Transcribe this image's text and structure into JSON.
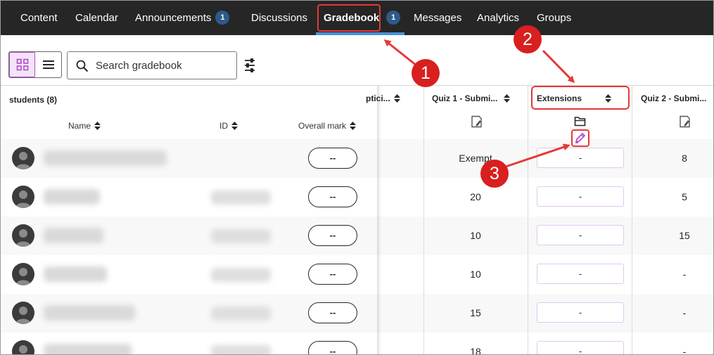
{
  "nav": {
    "items": [
      {
        "label": "Content"
      },
      {
        "label": "Calendar"
      },
      {
        "label": "Announcements",
        "badge": "1"
      },
      {
        "label": "Discussions"
      },
      {
        "label": "Gradebook",
        "badge": "1"
      },
      {
        "label": "Messages"
      },
      {
        "label": "Analytics"
      },
      {
        "label": "Groups"
      }
    ],
    "active": "Gradebook"
  },
  "toolbar": {
    "search_placeholder": "Search gradebook",
    "icons": [
      "grid-view-icon",
      "list-view-icon",
      "search-icon",
      "filter-settings-icon"
    ]
  },
  "grid": {
    "students_title": "students (8)",
    "columns": {
      "name": "Name",
      "id": "ID",
      "overall": "Overall mark"
    },
    "grade_columns": [
      {
        "label": "ptici..."
      },
      {
        "label": "Quiz 1 - Submi...",
        "icon": "assignment-icon"
      },
      {
        "label": "Extensions",
        "icon": "folder-icon"
      },
      {
        "label": "Quiz 2 - Submi...",
        "icon": "assignment-icon"
      }
    ],
    "rows": [
      {
        "overall": "--",
        "quiz1": "Exempt",
        "extension": "-",
        "quiz2": "8"
      },
      {
        "overall": "--",
        "quiz1": "20",
        "extension": "-",
        "quiz2": "5"
      },
      {
        "overall": "--",
        "quiz1": "10",
        "extension": "-",
        "quiz2": "15"
      },
      {
        "overall": "--",
        "quiz1": "10",
        "extension": "-",
        "quiz2": "-"
      },
      {
        "overall": "--",
        "quiz1": "15",
        "extension": "-",
        "quiz2": "-"
      },
      {
        "overall": "--",
        "quiz1": "18",
        "extension": "-",
        "quiz2": "-"
      }
    ]
  },
  "annotations": {
    "callouts": [
      "1",
      "2",
      "3"
    ],
    "color": "#d91f1f"
  },
  "colors": {
    "nav_bg": "#262626",
    "badge": "#2d5a8b",
    "accent_purple": "#b04cc9",
    "active_underline": "#4a90d9"
  }
}
